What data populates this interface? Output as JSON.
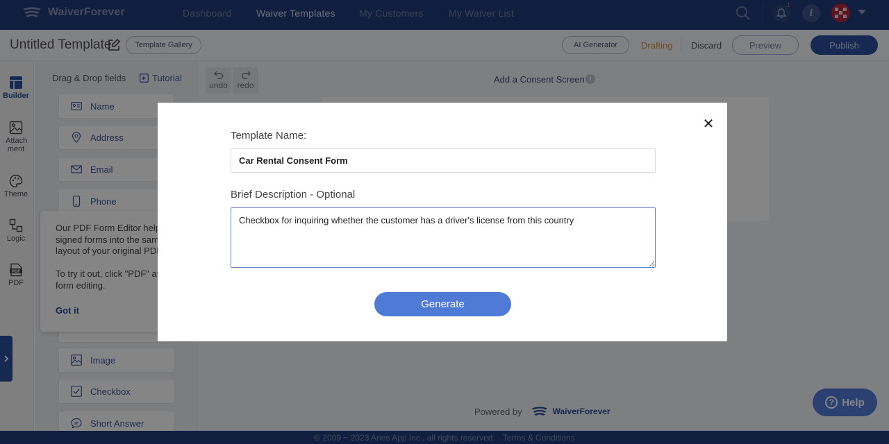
{
  "app": {
    "brand": "WaiverForever",
    "nav": [
      "Dashboard",
      "Waiver Templates",
      "My Customers",
      "My Waiver List"
    ],
    "active_nav": "Waiver Templates",
    "notification_count": "1"
  },
  "subheader": {
    "title": "Untitled Template",
    "template_gallery": "Template Gallery",
    "ai_generator": "AI Generator",
    "status": "Drafting",
    "discard": "Discard",
    "preview": "Preview",
    "publish": "Publish"
  },
  "rail": {
    "items": [
      {
        "label": "Builder",
        "icon": "builder-icon"
      },
      {
        "label": "Attach ment",
        "icon": "image-icon"
      },
      {
        "label": "Theme",
        "icon": "palette-icon"
      },
      {
        "label": "Logic",
        "icon": "logic-icon"
      },
      {
        "label": "PDF",
        "icon": "pdf-icon"
      }
    ]
  },
  "fields_panel": {
    "heading": "Drag & Drop fields",
    "tutorial": "Tutorial",
    "items": [
      {
        "label": "Name",
        "icon": "id-card-icon"
      },
      {
        "label": "Address",
        "icon": "location-pin-icon"
      },
      {
        "label": "Email",
        "icon": "envelope-icon"
      },
      {
        "label": "Phone",
        "icon": "phone-icon"
      },
      {
        "label": "Image",
        "icon": "image-icon"
      },
      {
        "label": "Checkbox",
        "icon": "checkbox-icon"
      },
      {
        "label": "Short Answer",
        "icon": "chat-icon"
      }
    ]
  },
  "canvas": {
    "undo": "undo",
    "redo": "redo",
    "consent_link": "Add a Consent Screen",
    "powered_by": "Powered by",
    "powered_brand": "WaiverForever"
  },
  "tooltip": {
    "lines1": [
      "Our PDF Form Editor helps",
      "signed forms into the same",
      "layout of your original PDF."
    ],
    "lines2": [
      "To try it out, click \"PDF\" afte",
      "form editing."
    ],
    "got_it": "Got it"
  },
  "help": "Help",
  "footer": {
    "copyright": "© 2009 ~ 2023 Aries App Inc., all rights reserved.",
    "terms": "Terms & Conditions"
  },
  "modal": {
    "name_label": "Template Name:",
    "name_value": "Car Rental Consent Form",
    "desc_label": "Brief Description - Optional",
    "desc_value": "Checkbox for inquiring whether the customer has a driver's license from this country",
    "generate": "Generate"
  },
  "colors": {
    "nav_bg": "#1f3a7a",
    "primary": "#2b4f9e",
    "accent_button": "#4f7bd7",
    "drafting": "#d6913a"
  }
}
